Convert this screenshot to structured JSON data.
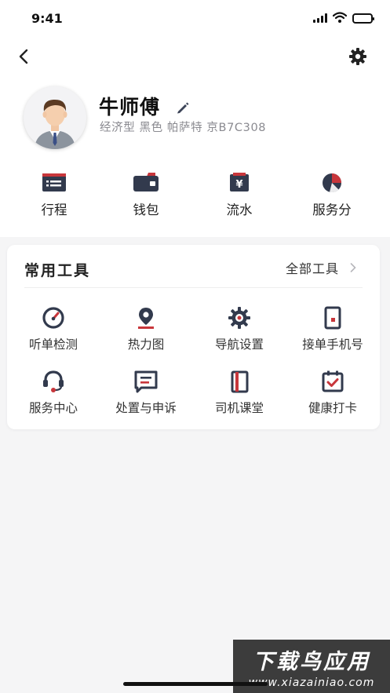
{
  "status_bar": {
    "time": "9:41",
    "icons": [
      "signal-icon",
      "wifi-icon",
      "battery-icon"
    ]
  },
  "header": {
    "back_icon": "chevron-left-icon",
    "settings_icon": "gear-icon"
  },
  "profile": {
    "name": "牛师傅",
    "edit_icon": "pencil-icon",
    "car_info": "经济型 黑色 帕萨特 京B7C308"
  },
  "quick_actions": [
    {
      "label": "行程",
      "icon": "trip-icon"
    },
    {
      "label": "钱包",
      "icon": "wallet-icon"
    },
    {
      "label": "流水",
      "icon": "income-icon"
    },
    {
      "label": "服务分",
      "icon": "service-score-icon"
    }
  ],
  "tools": {
    "title": "常用工具",
    "all_label": "全部工具",
    "items": [
      {
        "label": "听单检测",
        "icon": "gauge-icon"
      },
      {
        "label": "热力图",
        "icon": "location-pin-icon"
      },
      {
        "label": "导航设置",
        "icon": "nav-gear-icon"
      },
      {
        "label": "接单手机号",
        "icon": "phone-icon"
      },
      {
        "label": "服务中心",
        "icon": "headset-icon"
      },
      {
        "label": "处置与申诉",
        "icon": "message-icon"
      },
      {
        "label": "司机课堂",
        "icon": "book-icon"
      },
      {
        "label": "健康打卡",
        "icon": "calendar-check-icon"
      }
    ]
  },
  "watermark": {
    "main": "下载鸟应用",
    "url": "www.xiazainiao.com"
  },
  "colors": {
    "accent_red": "#c8363b",
    "dark_navy": "#323a4d",
    "background": "#f5f5f6"
  }
}
